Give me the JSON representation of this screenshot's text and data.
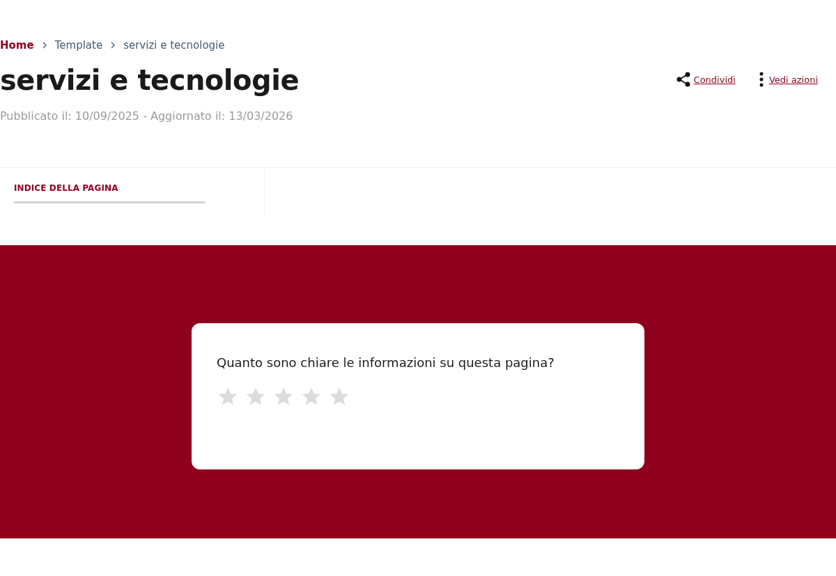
{
  "breadcrumb": [
    {
      "label": "Home"
    },
    {
      "label": "Template"
    },
    {
      "label": "servizi e tecnologie"
    }
  ],
  "page_title": "servizi e tecnologie",
  "dates": "Pubblicato il: 10/09/2025 - Aggiornato il: 13/03/2026",
  "actions": [
    {
      "kind": "share",
      "label": "Condividi"
    },
    {
      "kind": "more",
      "label": "Vedi azioni"
    }
  ],
  "page_index": {
    "title": "INDICE DELLA PAGINA",
    "progress": {
      "level": 0
    }
  },
  "rating": {
    "question": "Quanto sono chiare le informazioni su questa pagina?",
    "stars": 0
  }
}
